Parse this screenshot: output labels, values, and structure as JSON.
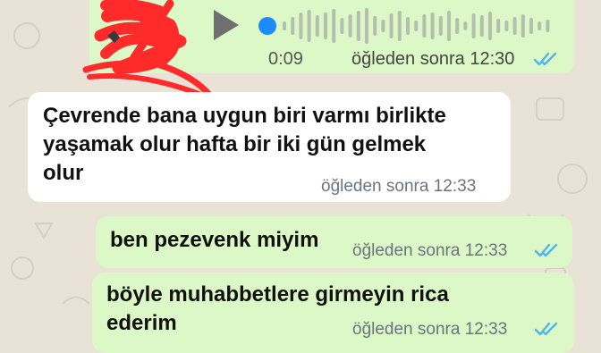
{
  "colors": {
    "background": "#e9e2d7",
    "outgoing_bubble": "#dcf8c6",
    "incoming_bubble": "#ffffff",
    "read_ticks": "#4fb6e9",
    "voice_dot": "#1a8cff",
    "scribble": "#ff2a2a"
  },
  "voice_message": {
    "duration": "0:09",
    "time": "öğleden sonra 12:30",
    "status": "read",
    "play_icon": "play-icon"
  },
  "messages": [
    {
      "direction": "incoming",
      "lines": [
        "Çevrende bana uygun biri varmı birlikte",
        "yaşamak olur hafta bir iki gün gelmek",
        "olur"
      ],
      "time": "öğleden sonra 12:33"
    },
    {
      "direction": "outgoing",
      "lines": [
        "ben pezevenk miyim"
      ],
      "time": "öğleden sonra 12:33",
      "status": "read"
    },
    {
      "direction": "outgoing",
      "lines": [
        "böyle muhabbetlere girmeyin rica",
        "ederim"
      ],
      "time": "öğleden sonra 12:33",
      "status": "read"
    }
  ]
}
